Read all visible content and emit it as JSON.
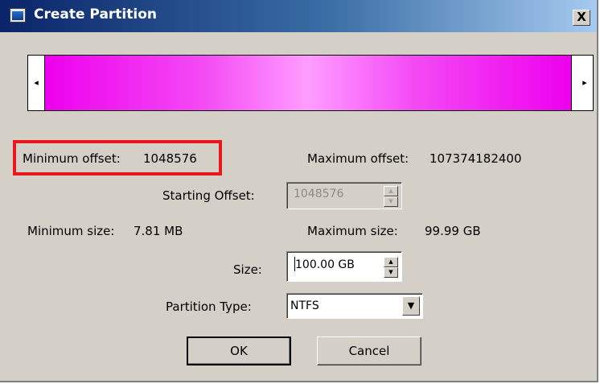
{
  "window": {
    "title": "Create Partition",
    "close_label": "X"
  },
  "partition_bar": {
    "left_arrow": "◂",
    "right_arrow": "▸",
    "fill_color": "#ee00ee"
  },
  "offsets": {
    "min_offset_label": "Minimum offset:",
    "min_offset_value": "1048576",
    "max_offset_label": "Maximum offset:",
    "max_offset_value": "107374182400",
    "starting_offset_label": "Starting Offset:",
    "starting_offset_value": "1048576"
  },
  "sizes": {
    "min_size_label": "Minimum size:",
    "min_size_value": "7.81 MB",
    "max_size_label": "Maximum size:",
    "max_size_value": "99.99 GB",
    "size_label": "Size:",
    "size_value": "100.00 GB"
  },
  "partition_type": {
    "label": "Partition Type:",
    "selected": "NTFS"
  },
  "buttons": {
    "ok": "OK",
    "cancel": "Cancel"
  },
  "colors": {
    "highlight": "#e8181d",
    "window_bg": "#d4d0c8",
    "titlebar": "#0a246a"
  }
}
